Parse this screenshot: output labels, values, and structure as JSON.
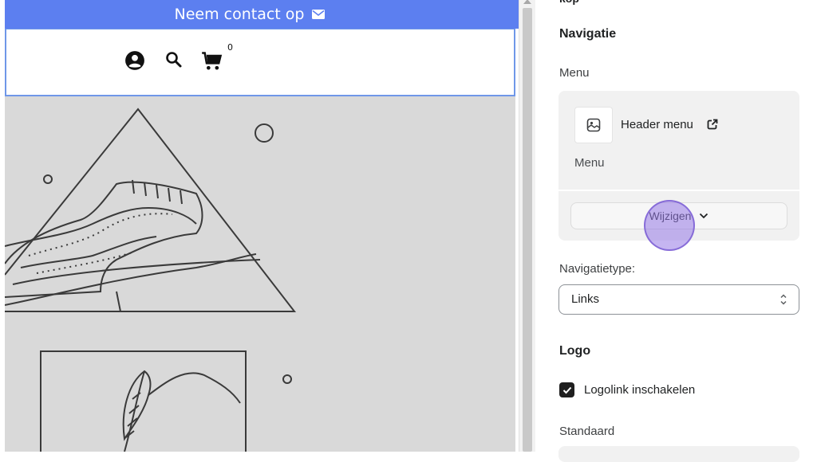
{
  "preview": {
    "announcement": "Neem contact op",
    "cart_count": "0"
  },
  "panel": {
    "section_fragment": "kop",
    "navigation_title": "Navigatie",
    "menu_label": "Menu",
    "menu_card": {
      "name": "Header menu",
      "subtitle": "Menu",
      "change_button": "Wijzigen"
    },
    "nav_type_label": "Navigatietype:",
    "nav_type_value": "Links",
    "logo_title": "Logo",
    "logo_link_label": "Logolink inschakelen",
    "logo_link_checked": true,
    "default_label": "Standaard"
  },
  "colors": {
    "announcement_bg": "#5c7ff0",
    "header_border": "#6f97e8",
    "canvas_bg": "#d9d9d9",
    "cursor": "#9678e6"
  }
}
